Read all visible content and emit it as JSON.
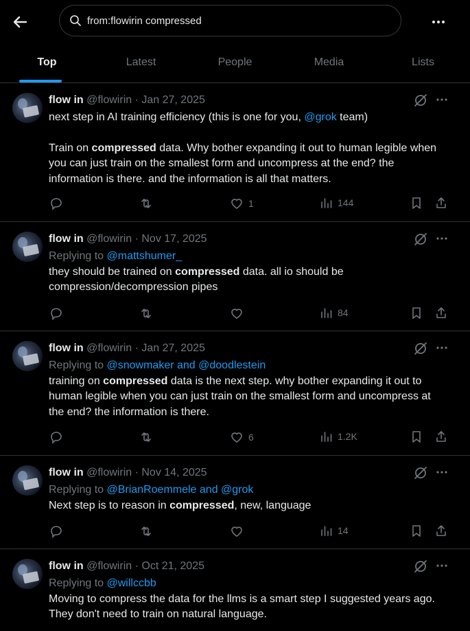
{
  "search": {
    "query": "from:flowirin compressed"
  },
  "tabs": [
    "Top",
    "Latest",
    "People",
    "Media",
    "Lists"
  ],
  "colors": {
    "accent": "#1d9bf0",
    "background": "#000000",
    "muted": "#71767b"
  },
  "icons": [
    "back-arrow-icon",
    "search-icon",
    "more-icon",
    "grok-icon",
    "reply-icon",
    "repost-icon",
    "like-icon",
    "views-icon",
    "bookmark-icon",
    "share-icon"
  ],
  "tweets": [
    {
      "name": "flow in",
      "handle": "@flowirin",
      "date": "· Jan 27, 2025",
      "line1a": "next step in AI training efficiency (this is one for you, ",
      "line1link": "@grok",
      "line1b": "  team)",
      "p2a": "Train on ",
      "p2bold": "compressed",
      "p2b": " data. Why bother expanding it out to human legible when you can just train on the smallest form and uncompress at the end? the information is there. and the information is all that matters.",
      "likes": "1",
      "views": "144"
    },
    {
      "name": "flow in",
      "handle": "@flowirin",
      "date": "· Nov 17, 2025",
      "replying": "Replying to ",
      "replyto": "@mattshumer_",
      "ta": "they should be trained on ",
      "tbold": "compressed",
      "tb": " data. all io should be compression/decompression pipes",
      "likes": "",
      "views": "84"
    },
    {
      "name": "flow in",
      "handle": "@flowirin",
      "date": "· Jan 27, 2025",
      "replying": "Replying to ",
      "replyto": "@snowmaker and @doodlestein",
      "ta": "training on ",
      "tbold": "compressed",
      "tb": " data is the next step. why bother expanding it out to human legible when you can just train on the smallest form and uncompress at the end? the information is there.",
      "likes": "6",
      "views": "1.2K"
    },
    {
      "name": "flow in",
      "handle": "@flowirin",
      "date": "· Nov 14, 2025",
      "replying": "Replying to ",
      "replyto": "@BrianRoemmele and @grok",
      "ta": "Next step is to reason in ",
      "tbold": "compressed",
      "tb": ", new, language",
      "likes": "",
      "views": "14"
    },
    {
      "name": "flow in",
      "handle": "@flowirin",
      "date": "· Oct 21, 2025",
      "replying": "Replying to ",
      "replyto": "@willccbb",
      "ta": "Moving to compress the data for the llms is a smart step I suggested years ago. They don't need to train on natural language.",
      "likes": "",
      "views": ""
    }
  ]
}
